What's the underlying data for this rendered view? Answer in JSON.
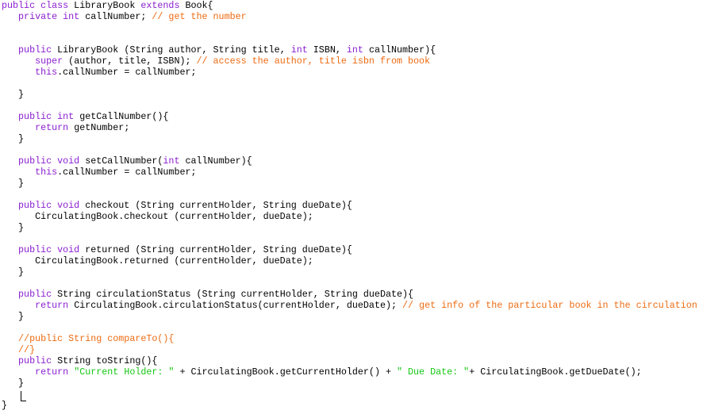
{
  "editor": {
    "language": "java",
    "colors": {
      "keyword": "#8a1fd0",
      "comment": "#ee6b12",
      "string": "#14c814",
      "text": "#000000",
      "background": "#ffffff"
    },
    "lines": [
      [
        {
          "t": "kw",
          "v": "public class"
        },
        {
          "t": "plain",
          "v": " LibraryBook "
        },
        {
          "t": "kw",
          "v": "extends"
        },
        {
          "t": "plain",
          "v": " Book{"
        }
      ],
      [
        {
          "t": "plain",
          "v": "   "
        },
        {
          "t": "kw",
          "v": "private int"
        },
        {
          "t": "plain",
          "v": " callNumber; "
        },
        {
          "t": "cm",
          "v": "// get the number"
        }
      ],
      [],
      [],
      [
        {
          "t": "plain",
          "v": "   "
        },
        {
          "t": "kw",
          "v": "public"
        },
        {
          "t": "plain",
          "v": " LibraryBook (String author, String title, "
        },
        {
          "t": "kw",
          "v": "int"
        },
        {
          "t": "plain",
          "v": " ISBN, "
        },
        {
          "t": "kw",
          "v": "int"
        },
        {
          "t": "plain",
          "v": " callNumber){"
        }
      ],
      [
        {
          "t": "plain",
          "v": "      "
        },
        {
          "t": "kw",
          "v": "super"
        },
        {
          "t": "plain",
          "v": " (author, title, ISBN); "
        },
        {
          "t": "cm",
          "v": "// access the author, title isbn from book"
        }
      ],
      [
        {
          "t": "plain",
          "v": "      "
        },
        {
          "t": "kw",
          "v": "this"
        },
        {
          "t": "plain",
          "v": ".callNumber = callNumber;"
        }
      ],
      [],
      [
        {
          "t": "plain",
          "v": "   }"
        }
      ],
      [],
      [
        {
          "t": "plain",
          "v": "   "
        },
        {
          "t": "kw",
          "v": "public int"
        },
        {
          "t": "plain",
          "v": " getCallNumber(){"
        }
      ],
      [
        {
          "t": "plain",
          "v": "      "
        },
        {
          "t": "kw",
          "v": "return"
        },
        {
          "t": "plain",
          "v": " getNumber;"
        }
      ],
      [
        {
          "t": "plain",
          "v": "   }"
        }
      ],
      [],
      [
        {
          "t": "plain",
          "v": "   "
        },
        {
          "t": "kw",
          "v": "public void"
        },
        {
          "t": "plain",
          "v": " setCallNumber("
        },
        {
          "t": "kw",
          "v": "int"
        },
        {
          "t": "plain",
          "v": " callNumber){"
        }
      ],
      [
        {
          "t": "plain",
          "v": "      "
        },
        {
          "t": "kw",
          "v": "this"
        },
        {
          "t": "plain",
          "v": ".callNumber = callNumber;"
        }
      ],
      [
        {
          "t": "plain",
          "v": "   }"
        }
      ],
      [],
      [
        {
          "t": "plain",
          "v": "   "
        },
        {
          "t": "kw",
          "v": "public void"
        },
        {
          "t": "plain",
          "v": " checkout (String currentHolder, String dueDate){"
        }
      ],
      [
        {
          "t": "plain",
          "v": "      CirculatingBook.checkout (currentHolder, dueDate);"
        }
      ],
      [
        {
          "t": "plain",
          "v": "   }"
        }
      ],
      [],
      [
        {
          "t": "plain",
          "v": "   "
        },
        {
          "t": "kw",
          "v": "public void"
        },
        {
          "t": "plain",
          "v": " returned (String currentHolder, String dueDate){"
        }
      ],
      [
        {
          "t": "plain",
          "v": "      CirculatingBook.returned (currentHolder, dueDate);"
        }
      ],
      [
        {
          "t": "plain",
          "v": "   }"
        }
      ],
      [],
      [
        {
          "t": "plain",
          "v": "   "
        },
        {
          "t": "kw",
          "v": "public"
        },
        {
          "t": "plain",
          "v": " String circulationStatus (String currentHolder, String dueDate){"
        }
      ],
      [
        {
          "t": "plain",
          "v": "      "
        },
        {
          "t": "kw",
          "v": "return"
        },
        {
          "t": "plain",
          "v": " CirculatingBook.circulationStatus(currentHolder, dueDate); "
        },
        {
          "t": "cm",
          "v": "// get info of the particular book in the circulation"
        }
      ],
      [
        {
          "t": "plain",
          "v": "   }"
        }
      ],
      [],
      [
        {
          "t": "plain",
          "v": "   "
        },
        {
          "t": "cm",
          "v": "//public String compareTo(){"
        }
      ],
      [
        {
          "t": "plain",
          "v": "   "
        },
        {
          "t": "cm",
          "v": "//}"
        }
      ],
      [
        {
          "t": "plain",
          "v": "   "
        },
        {
          "t": "kw",
          "v": "public"
        },
        {
          "t": "plain",
          "v": " String toString(){"
        }
      ],
      [
        {
          "t": "plain",
          "v": "      "
        },
        {
          "t": "kw",
          "v": "return"
        },
        {
          "t": "plain",
          "v": " "
        },
        {
          "t": "str",
          "v": "\"Current Holder: \""
        },
        {
          "t": "plain",
          "v": " + CirculatingBook.getCurrentHolder() + "
        },
        {
          "t": "str",
          "v": "\" Due Date: \""
        },
        {
          "t": "plain",
          "v": "+ CirculatingBook.getDueDate();"
        }
      ],
      [
        {
          "t": "plain",
          "v": "   }"
        }
      ],
      [],
      [
        {
          "t": "plain",
          "v": "}"
        }
      ]
    ]
  }
}
